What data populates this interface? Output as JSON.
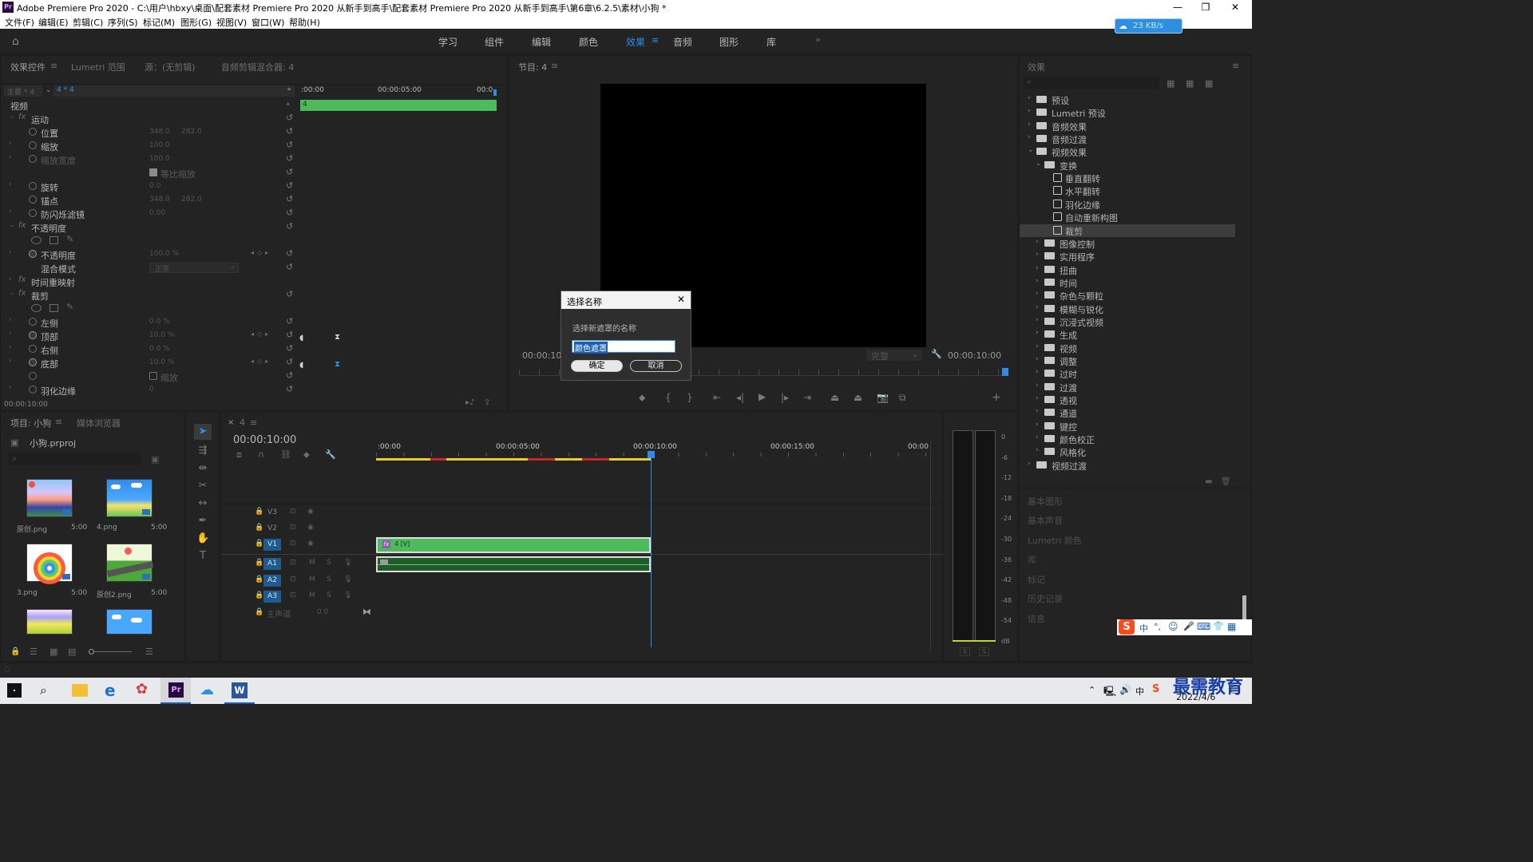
{
  "window": {
    "title": "Adobe Premiere Pro 2020 - C:\\用户\\hbxy\\桌面\\配套素材 Premiere Pro 2020 从新手到高手\\配套素材 Premiere Pro 2020 从新手到高手\\第6章\\6.2.5\\素材\\小狗 *",
    "logo": "Pr",
    "minimize": "—",
    "maximize": "❐",
    "close": "✕"
  },
  "menu": [
    "文件(F)",
    "编辑(E)",
    "剪辑(C)",
    "序列(S)",
    "标记(M)",
    "图形(G)",
    "视图(V)",
    "窗口(W)",
    "帮助(H)"
  ],
  "workspaces": [
    "学习",
    "组件",
    "编辑",
    "颜色",
    "效果",
    "音频",
    "图形",
    "库"
  ],
  "workspace_active": "效果",
  "net_badge": "23 KB/s",
  "effect_controls": {
    "tabs": [
      "效果控件",
      "Lumetri 范围",
      "源：(无剪辑)",
      "音频剪辑混合器: 4"
    ],
    "source": "主要 * 4",
    "seq": "4 * 4",
    "section": "视频",
    "time_start": ":00:00",
    "time_mid": "00:00:05:00",
    "time_end": "00:0",
    "clip_label": "4",
    "props": [
      {
        "name": "运动",
        "kind": "group"
      },
      {
        "name": "位置",
        "v1": "348.0",
        "v2": "282.0"
      },
      {
        "name": "缩放",
        "v1": "100.0"
      },
      {
        "name": "缩放宽度",
        "v1": "100.0",
        "dim": true
      },
      {
        "name": "等比缩放",
        "kind": "check"
      },
      {
        "name": "旋转",
        "v1": "0.0"
      },
      {
        "name": "锚点",
        "v1": "348.0",
        "v2": "282.0"
      },
      {
        "name": "防闪烁滤镜",
        "v1": "0.00"
      },
      {
        "name": "不透明度",
        "kind": "group"
      },
      {
        "name": "",
        "kind": "masks"
      },
      {
        "name": "不透明度",
        "v1": "100.0 %",
        "kf": true
      },
      {
        "name": "混合模式",
        "v1": "正常",
        "kind": "select"
      },
      {
        "name": "时间重映射",
        "kind": "group"
      },
      {
        "name": "裁剪",
        "kind": "group"
      },
      {
        "name": "",
        "kind": "masks"
      },
      {
        "name": "左侧",
        "v1": "0.0 %"
      },
      {
        "name": "顶部",
        "v1": "10.0 %",
        "kf": true
      },
      {
        "name": "右侧",
        "v1": "0.0 %"
      },
      {
        "name": "底部",
        "v1": "10.0 %",
        "kf": true
      },
      {
        "name": "缩放",
        "kind": "check2"
      },
      {
        "name": "羽化边缘",
        "v1": "0"
      }
    ],
    "footer_time": "00:00:10:00"
  },
  "program": {
    "tab": "节目: 4",
    "time_left": "00:00:10:",
    "time_right": "00:00:10:00",
    "fit": "完整"
  },
  "dialog": {
    "title": "选择名称",
    "close": "✕",
    "prompt": "选择新遮罩的名称",
    "value": "颜色遮罩",
    "ok": "确定",
    "cancel": "取消"
  },
  "effects": {
    "tab": "效果",
    "tree": [
      {
        "label": "预设",
        "level": 0,
        "type": "bin",
        "open": false
      },
      {
        "label": "Lumetri 预设",
        "level": 0,
        "type": "bin",
        "open": false
      },
      {
        "label": "音频效果",
        "level": 0,
        "type": "folder",
        "open": false
      },
      {
        "label": "音频过渡",
        "level": 0,
        "type": "folder",
        "open": false
      },
      {
        "label": "视频效果",
        "level": 0,
        "type": "folder",
        "open": true
      },
      {
        "label": "变换",
        "level": 1,
        "type": "folder",
        "open": true
      },
      {
        "label": "垂直翻转",
        "level": 2,
        "type": "fx"
      },
      {
        "label": "水平翻转",
        "level": 2,
        "type": "fx"
      },
      {
        "label": "羽化边缘",
        "level": 2,
        "type": "fx"
      },
      {
        "label": "自动重新构图",
        "level": 2,
        "type": "fx"
      },
      {
        "label": "裁剪",
        "level": 2,
        "type": "fx",
        "selected": true
      },
      {
        "label": "图像控制",
        "level": 1,
        "type": "folder"
      },
      {
        "label": "实用程序",
        "level": 1,
        "type": "folder"
      },
      {
        "label": "扭曲",
        "level": 1,
        "type": "folder"
      },
      {
        "label": "时间",
        "level": 1,
        "type": "folder"
      },
      {
        "label": "杂色与颗粒",
        "level": 1,
        "type": "folder"
      },
      {
        "label": "模糊与锐化",
        "level": 1,
        "type": "folder"
      },
      {
        "label": "沉浸式视频",
        "level": 1,
        "type": "folder"
      },
      {
        "label": "生成",
        "level": 1,
        "type": "folder"
      },
      {
        "label": "视频",
        "level": 1,
        "type": "folder"
      },
      {
        "label": "调整",
        "level": 1,
        "type": "folder"
      },
      {
        "label": "过时",
        "level": 1,
        "type": "folder"
      },
      {
        "label": "过渡",
        "level": 1,
        "type": "folder"
      },
      {
        "label": "透视",
        "level": 1,
        "type": "folder"
      },
      {
        "label": "通道",
        "level": 1,
        "type": "folder"
      },
      {
        "label": "键控",
        "level": 1,
        "type": "folder"
      },
      {
        "label": "颜色校正",
        "level": 1,
        "type": "folder"
      },
      {
        "label": "风格化",
        "level": 1,
        "type": "folder"
      },
      {
        "label": "视频过渡",
        "level": 0,
        "type": "folder",
        "open": false
      }
    ],
    "panels": [
      "基本图形",
      "基本声音",
      "Lumetri 颜色",
      "库",
      "标记",
      "历史记录",
      "信息"
    ]
  },
  "project": {
    "tabs": [
      "项目: 小狗",
      "媒体浏览器"
    ],
    "file": "小狗.prproj",
    "items": [
      {
        "name": "原创.png",
        "dur": "5:00"
      },
      {
        "name": "4.png",
        "dur": "5:00"
      },
      {
        "name": "3.png",
        "dur": "5:00"
      },
      {
        "name": "原创2.png",
        "dur": "5:00"
      },
      {
        "name": "",
        "dur": ""
      },
      {
        "name": "",
        "dur": ""
      }
    ]
  },
  "timeline": {
    "tab": "4",
    "time": "00:00:10:00",
    "ruler": [
      ":00:00",
      "00:00:05:00",
      "00:00:10:00",
      "00:00:15:00",
      "00:00"
    ],
    "tracks": [
      "V3",
      "V2",
      "V1",
      "A1",
      "A2",
      "A3"
    ],
    "master": "主声道",
    "master_val": "0.0",
    "clip_label": "4 [V]",
    "fx_badge": "fx"
  },
  "meter": {
    "scale": [
      "0",
      "-6",
      "-12",
      "-18",
      "-24",
      "-30",
      "-36",
      "-42",
      "-48",
      "-54",
      "dB"
    ],
    "s1": "S",
    "s2": "S"
  },
  "ime": [
    "中",
    "°,",
    "☺",
    "🎤",
    "⌨",
    "👕",
    "▦"
  ],
  "taskbar": {
    "date": "2022/4/6",
    "brand": "最需教育",
    "ime_char": "中"
  }
}
